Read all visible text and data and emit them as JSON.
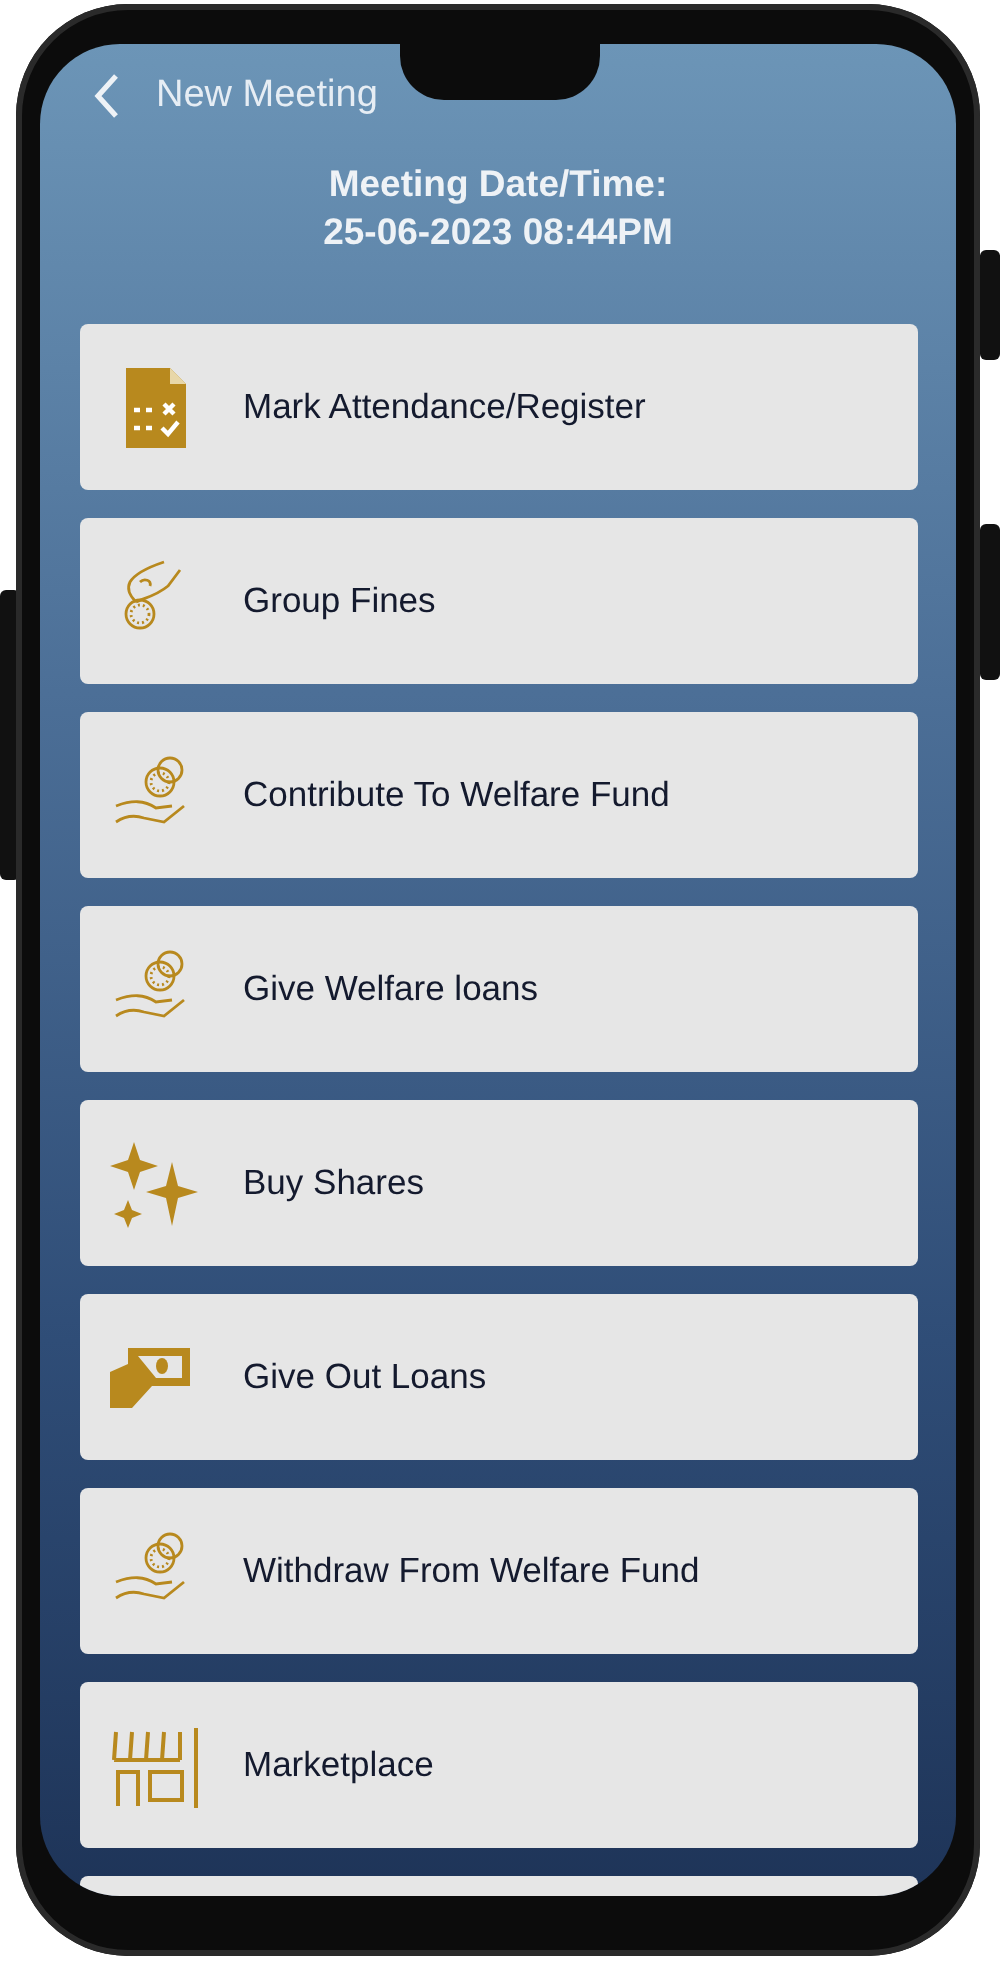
{
  "header": {
    "title": "New Meeting"
  },
  "meeting": {
    "label": "Meeting Date/Time:",
    "value": "25-06-2023 08:44PM"
  },
  "menu": [
    {
      "label": "Mark Attendance/Register"
    },
    {
      "label": "Group Fines"
    },
    {
      "label": "Contribute To Welfare Fund"
    },
    {
      "label": "Give Welfare loans"
    },
    {
      "label": "Buy Shares"
    },
    {
      "label": "Give Out Loans"
    },
    {
      "label": "Withdraw From Welfare Fund"
    },
    {
      "label": "Marketplace"
    }
  ]
}
